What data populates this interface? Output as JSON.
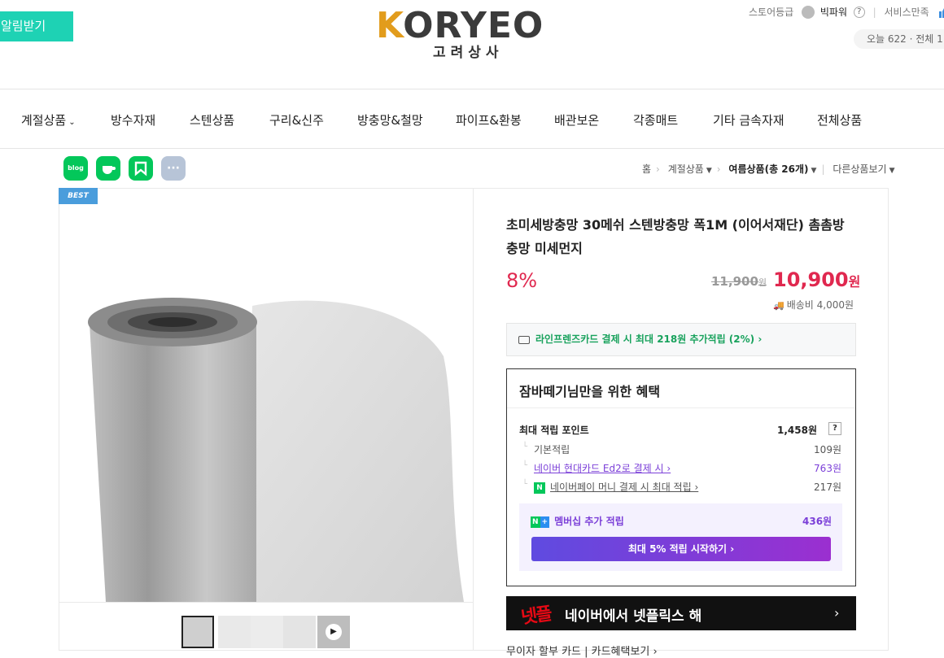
{
  "header": {
    "notify_label": "알림받기",
    "logo_word": "KORYEO",
    "logo_sub": "고려상사",
    "store_grade_label": "스토어등급",
    "store_grade_value": "빅파워",
    "service_label": "서비스만족",
    "visits_text": "오늘 622 · 전체 1"
  },
  "nav": {
    "items": [
      "계절상품",
      "방수자재",
      "스텐상품",
      "구리&신주",
      "방충망&철망",
      "파이프&환봉",
      "배관보온",
      "각종매트",
      "기타 금속자재",
      "전체상품"
    ]
  },
  "share": {
    "blog": "blog",
    "cafe": "",
    "more": "···"
  },
  "breadcrumb": {
    "home": "홈",
    "category": "계절상품",
    "current": "여름상품(총 26개)",
    "other": "다른상품보기"
  },
  "product": {
    "badge": "BEST",
    "title": "초미세방충망 30메쉬 스텐방충망 폭1M (이어서재단) 촘촘방충망 미세먼지",
    "discount": "8%",
    "original_price": "11,900",
    "original_unit": "원",
    "sale_price": "10,900",
    "sale_unit": "원",
    "shipping": "배송비 4,000원"
  },
  "card_promo": "라인프렌즈카드 결제 시 최대 218원 추가적립 (2%) ›",
  "benefits": {
    "title": "잠바떼기님만을 위한 혜택",
    "max_points_label": "최대 적립 포인트",
    "max_points_value": "1,458원",
    "rows": [
      {
        "label": "기본적립",
        "value": "109원"
      },
      {
        "label": "네이버 현대카드 Ed2로 결제 시 ›",
        "value": "763원"
      },
      {
        "label": "네이버페이 머니 결제 시 최대 적립 ›",
        "value": "217원"
      }
    ],
    "membership_label": "멤버십 추가 적립",
    "membership_value": "436원",
    "membership_button": "최대 5% 적립 시작하기 ›"
  },
  "netflix": {
    "logo": "넷플",
    "text": "네이버에서 넷플릭스 해",
    "chevron": "›"
  },
  "bottom_links": "무이자 할부 카드 | 카드혜택보기 ›"
}
